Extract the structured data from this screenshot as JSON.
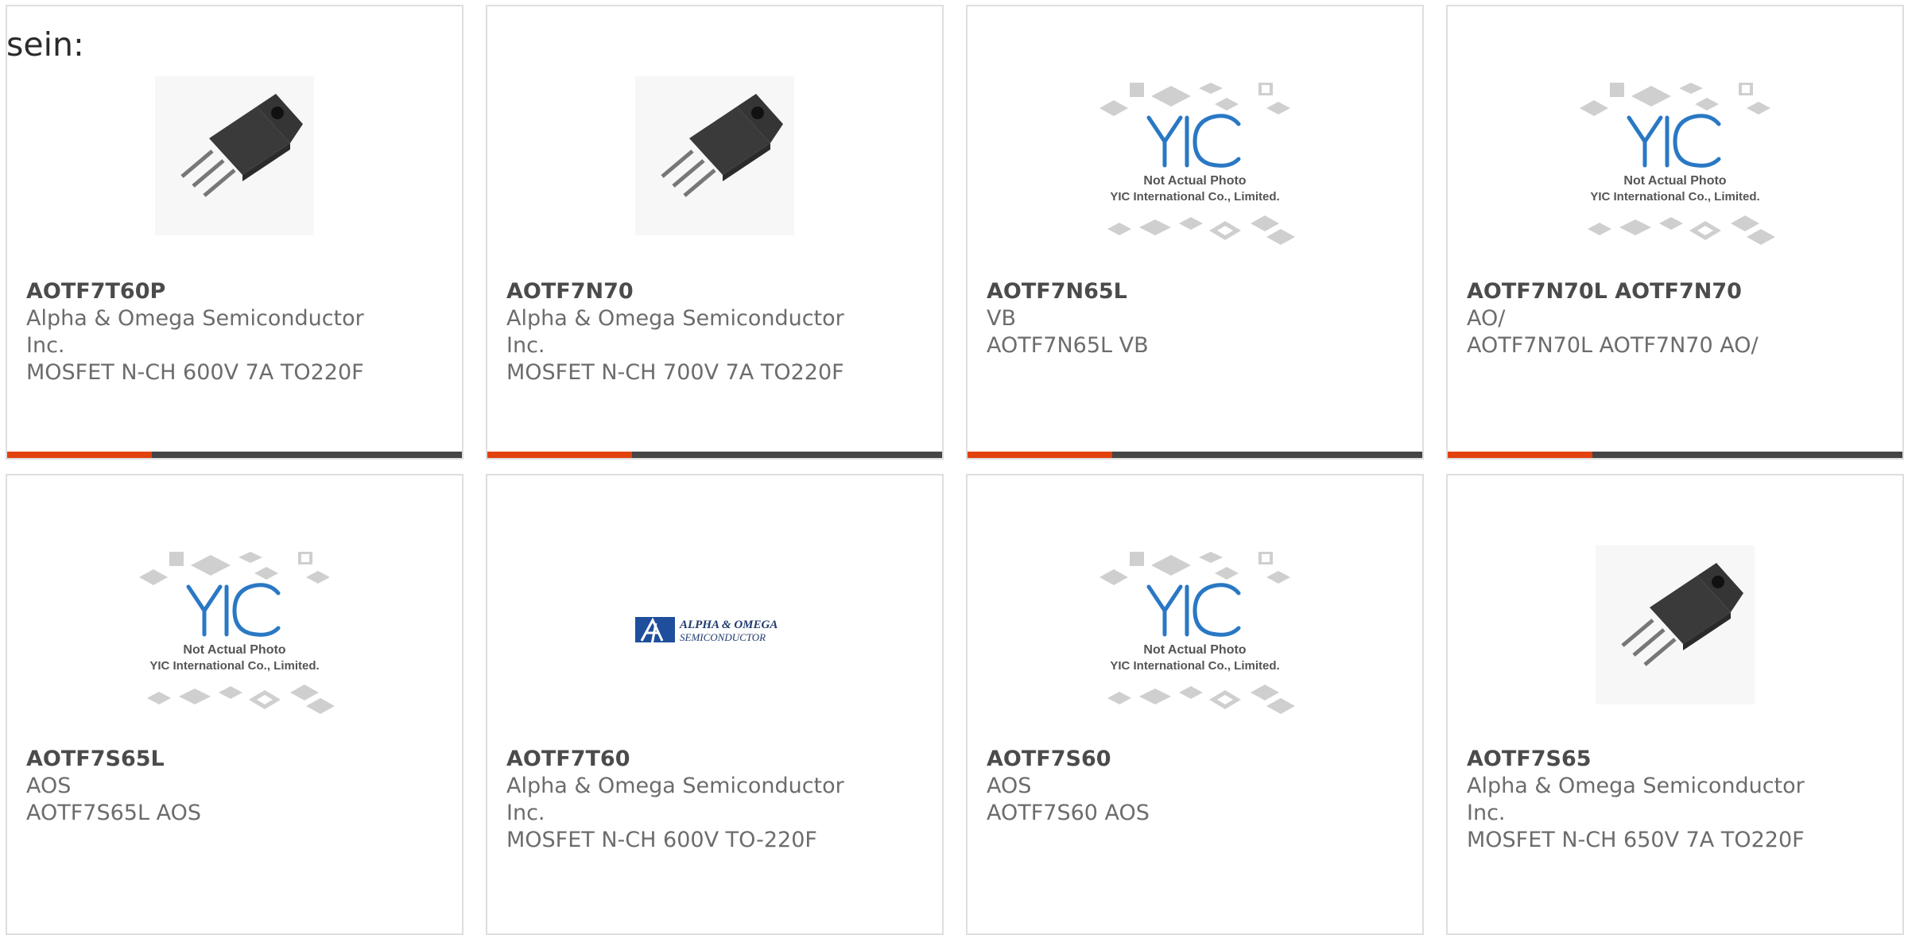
{
  "lead_text": "sein:",
  "colors": {
    "accent": "#e2420e",
    "bar_dark": "#454545",
    "border": "#dedede"
  },
  "products": [
    {
      "part": "AOTF7T60P",
      "line1": "Alpha & Omega Semiconductor",
      "line2": "Inc.",
      "line3": "MOSFET N-CH 600V 7A TO220F",
      "image": "transistor-photo"
    },
    {
      "part": "AOTF7N70",
      "line1": "Alpha & Omega Semiconductor",
      "line2": "Inc.",
      "line3": "MOSFET N-CH 700V 7A TO220F",
      "image": "transistor-photo"
    },
    {
      "part": "AOTF7N65L",
      "line1": "VB",
      "line2": "AOTF7N65L VB",
      "line3": "",
      "image": "yic-placeholder"
    },
    {
      "part": "AOTF7N70L AOTF7N70",
      "line1": "AO/",
      "line2": "AOTF7N70L AOTF7N70 AO/",
      "line3": "",
      "image": "yic-placeholder"
    },
    {
      "part": "AOTF7S65L",
      "line1": "AOS",
      "line2": "AOTF7S65L AOS",
      "line3": "",
      "image": "yic-placeholder"
    },
    {
      "part": "AOTF7T60",
      "line1": "Alpha & Omega Semiconductor",
      "line2": "Inc.",
      "line3": "MOSFET N-CH 600V TO-220F",
      "image": "aos-logo"
    },
    {
      "part": "AOTF7S60",
      "line1": "AOS",
      "line2": "AOTF7S60 AOS",
      "line3": "",
      "image": "yic-placeholder"
    },
    {
      "part": "AOTF7S65",
      "line1": "Alpha & Omega Semiconductor",
      "line2": "Inc.",
      "line3": "MOSFET N-CH 650V 7A TO220F",
      "image": "transistor-photo"
    }
  ],
  "placeholder": {
    "brand": "YIC",
    "line1": "Not Actual Photo",
    "line2": "YIC International Co., Limited."
  },
  "aos_logo": {
    "line1": "ALPHA & OMEGA",
    "line2": "SEMICONDUCTOR"
  }
}
